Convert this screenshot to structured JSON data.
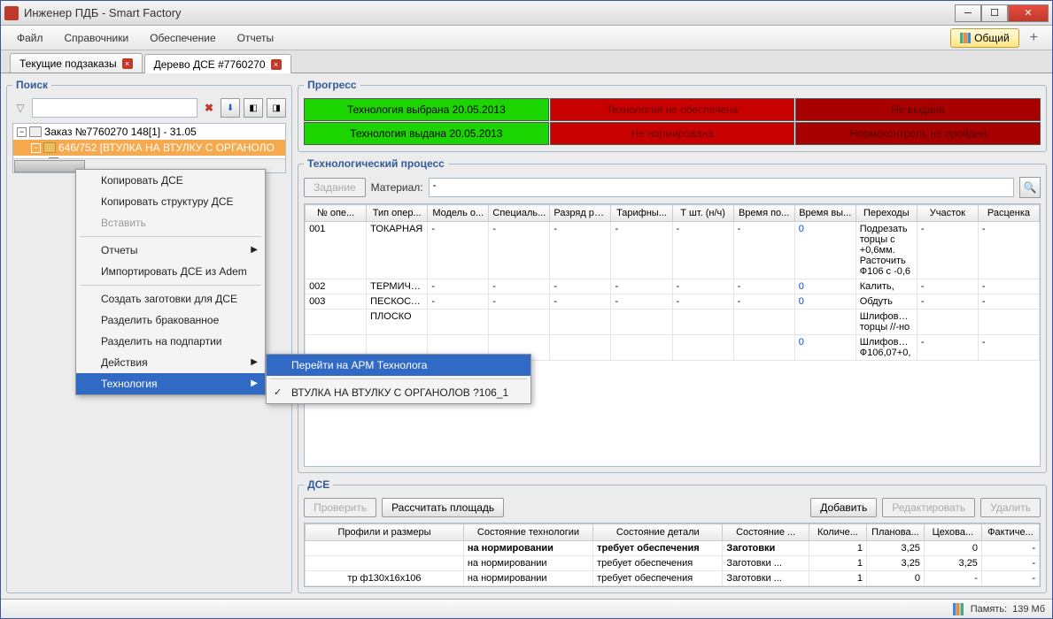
{
  "window_title": "Инженер ПДБ - Smart Factory",
  "menu": {
    "file": "Файл",
    "ref": "Справочники",
    "prov": "Обеспечение",
    "rep": "Отчеты",
    "mode": "Общий"
  },
  "tabs": [
    {
      "label": "Текущие подзаказы"
    },
    {
      "label": "Дерево ДСЕ #7760270"
    }
  ],
  "search": {
    "legend": "Поиск"
  },
  "tree": {
    "order": "Заказ №7760270 148[1] - 31.05",
    "selected": "646/752 [ВТУЛКА НА ВТУЛКУ С ОРГАНОЛО"
  },
  "context": {
    "items": [
      "Копировать ДСЕ",
      "Копировать структуру ДСЕ",
      "Вставить",
      "sep",
      "Отчеты",
      "Импортировать ДСЕ из Adem",
      "sep",
      "Создать заготовки для ДСЕ",
      "Разделить бракованное",
      "Разделить на подпартии",
      "Действия",
      "Технология"
    ],
    "disabled_idx": 2,
    "arrow_idx": [
      4,
      10,
      11
    ],
    "sel_idx": 11,
    "sub": {
      "goto": "Перейти на АРМ Технолога",
      "item": "ВТУЛКА НА ВТУЛКУ С ОРГАНОЛОВ ?106_1"
    }
  },
  "progress": {
    "legend": "Прогресс",
    "r1": [
      "Технология выбрана 20.05.2013",
      "Технология не обеспечена",
      "Не выдана"
    ],
    "r2": [
      "Технология выдана 20.05.2013",
      "Не нормирована",
      "Нормоконтроль не пройден"
    ]
  },
  "tech": {
    "legend": "Технологический процесс",
    "task": "Задание",
    "mat_label": "Материал:",
    "mat_value": "-",
    "cols": [
      "№ опе...",
      "Тип опер...",
      "Модель о...",
      "Специаль...",
      "Разряд ра...",
      "Тарифны...",
      "Т шт. (н/ч)",
      "Время по...",
      "Время вы...",
      "Переходы",
      "Участок",
      "Расценка"
    ],
    "rows": [
      [
        "001",
        "ТОКАРНАЯ",
        "-",
        "-",
        "-",
        "-",
        "-",
        "-",
        "0",
        "Подрезать торцы с +0,6мм. Расточить Ф106 с -0,6",
        "-",
        "-"
      ],
      [
        "002",
        "ТЕРМИЧЕ...",
        "-",
        "-",
        "-",
        "-",
        "-",
        "-",
        "0",
        "Калить,",
        "-",
        "-"
      ],
      [
        "003",
        "ПЕСКОСТ...",
        "-",
        "-",
        "-",
        "-",
        "-",
        "-",
        "0",
        "Обдуть",
        "-",
        "-"
      ],
      [
        "",
        "ПЛОСКО",
        "",
        "",
        "",
        "",
        "",
        "",
        "",
        "Шлифовать торцы //-но",
        "",
        ""
      ],
      [
        "",
        "",
        "",
        "",
        "",
        "",
        "",
        "",
        "0",
        "Шлифовать Ф106,07+0,",
        "-",
        "-"
      ]
    ]
  },
  "dse": {
    "legend": "ДСЕ",
    "check": "Проверить",
    "calc": "Рассчитать площадь",
    "add": "Добавить",
    "edit": "Редактировать",
    "del": "Удалить",
    "cols": [
      "Профили и размеры",
      "Состояние технологии",
      "Состояние детали",
      "Состояние ...",
      "Количе...",
      "Планова...",
      "Цехова...",
      "Фактиче..."
    ],
    "rows": [
      [
        "",
        "на нормировании",
        "требует обеспечения",
        "Заготовки",
        "1",
        "3,25",
        "0",
        "-"
      ],
      [
        "",
        "на нормировании",
        "требует обеспечения",
        "Заготовки ...",
        "1",
        "3,25",
        "3,25",
        "-"
      ],
      [
        "тр ф130x16x106",
        "на нормировании",
        "требует обеспечения",
        "Заготовки ...",
        "1",
        "0",
        "-",
        "-"
      ]
    ],
    "bold_row": 0
  },
  "status": {
    "mem_label": "Память:",
    "mem_val": "139 Мб"
  }
}
